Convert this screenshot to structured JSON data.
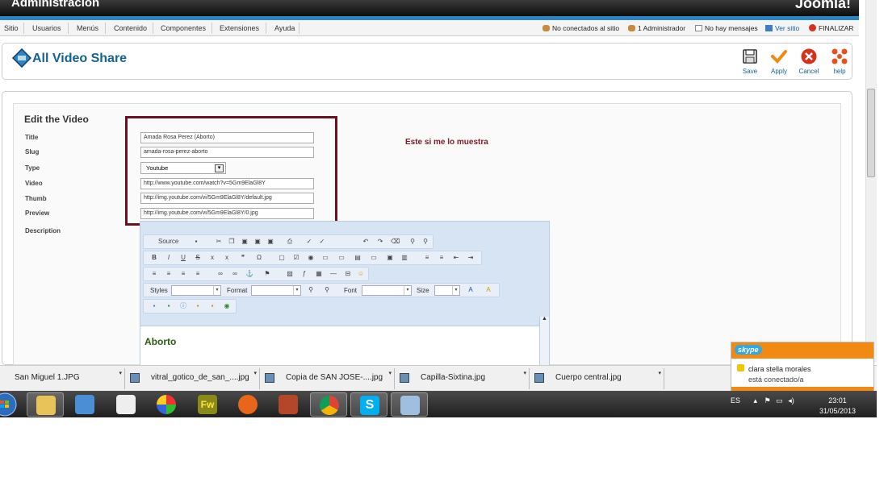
{
  "header": {
    "title": "Administración",
    "logo": "Joomla!"
  },
  "menu": {
    "items": [
      "Sitio",
      "Usuarios",
      "Menús",
      "Contenido",
      "Componentes",
      "Extensiones",
      "Ayuda"
    ]
  },
  "status": {
    "online": "No conectados al sitio",
    "admins": "1 Administrador",
    "messages": "No hay mensajes",
    "view_site": "Ver sitio",
    "logout": "FINALIZAR"
  },
  "page": {
    "title": "All Video Share"
  },
  "toolbar": {
    "save": "Save",
    "apply": "Apply",
    "cancel": "Cancel",
    "help": "help"
  },
  "form": {
    "heading": "Edit the Video",
    "labels": {
      "title": "Title",
      "slug": "Slug",
      "type": "Type",
      "video": "Video",
      "thumb": "Thumb",
      "preview": "Preview",
      "description": "Description"
    },
    "values": {
      "title": "Amada Rosa Perez (Aborto)",
      "slug": "amada-rosa-perez-aborto",
      "type": "Youtube",
      "video": "http://www.youtube.com/watch?v=5Gm9ElaGl8Y",
      "thumb": "http://img.youtube.com/vi/5Gm9ElaGl8Y/default.jpg",
      "preview": "http://img.youtube.com/vi/5Gm9ElaGl8Y/0.jpg"
    }
  },
  "annotation": "Este si me lo muestra",
  "editor": {
    "source": "Source",
    "styles": "Styles",
    "format": "Format",
    "font": "Font",
    "size": "Size",
    "content_heading": "Aborto"
  },
  "downloads": [
    "San Miguel 1.JPG",
    "vitral_gotico_de_san_....jpg",
    "Copia de SAN JOSE-....jpg",
    "Capilla-Sixtina.jpg",
    "Cuerpo central.jpg"
  ],
  "skype": {
    "brand": "skype",
    "name": "clara stella morales",
    "status": "está conectado/a"
  },
  "tray": {
    "lang": "ES",
    "time": "23:01",
    "date": "31/05/2013"
  },
  "colors": {
    "accent_blue": "#146295",
    "joomla_bar": "#2c84c4",
    "highlight_box": "#6b0f22",
    "apply_orange": "#f08a12",
    "cancel_red": "#d9301c"
  }
}
